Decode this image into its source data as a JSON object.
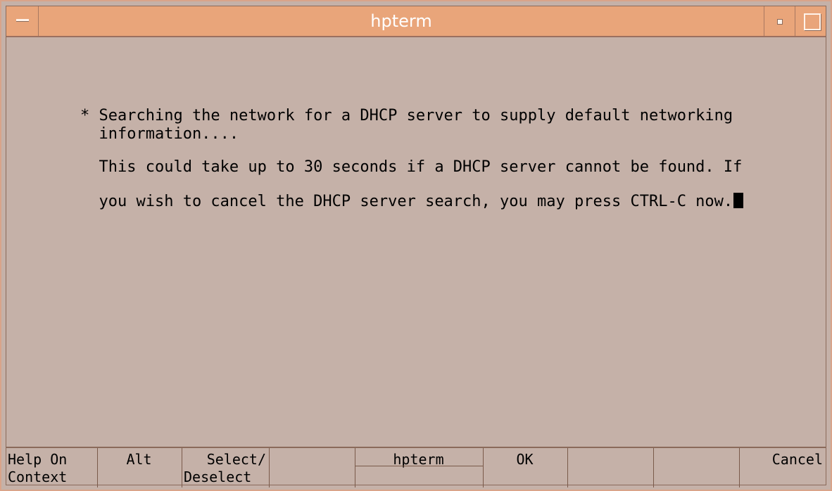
{
  "window": {
    "title": "hpterm"
  },
  "terminal": {
    "lines": [
      "* Searching the network for a DHCP server to supply default networking",
      "  information....",
      "  This could take up to 30 seconds if a DHCP server cannot be found. If",
      "  you wish to cancel the DHCP server search, you may press CTRL-C now."
    ]
  },
  "softkeys": [
    {
      "line1": "Help On",
      "line2": "Context"
    },
    {
      "line1": "Alt",
      "line2": ""
    },
    {
      "line1": "Select/",
      "line2": "Deselect"
    },
    {
      "line1": "",
      "line2": ""
    },
    {
      "line1": "hpterm",
      "line2": ""
    },
    {
      "line1": "OK",
      "line2": ""
    },
    {
      "line1": "",
      "line2": ""
    },
    {
      "line1": "",
      "line2": ""
    },
    {
      "line1": "Cancel",
      "line2": ""
    }
  ]
}
